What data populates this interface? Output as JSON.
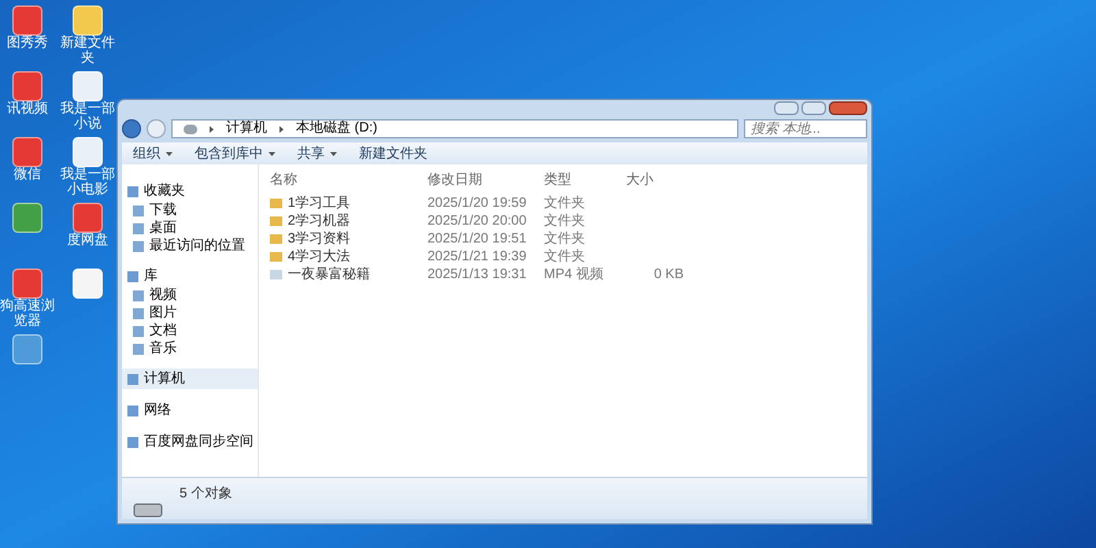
{
  "desktop_icons": [
    {
      "kind": "app",
      "label": "图秀秀"
    },
    {
      "kind": "folder",
      "label": "新建文件夹"
    },
    {
      "kind": "app",
      "label": "讯视频"
    },
    {
      "kind": "video",
      "label": "我是一部小说"
    },
    {
      "kind": "app",
      "label": "微信"
    },
    {
      "kind": "video",
      "label": "我是一部小电影"
    },
    {
      "kind": "sheet"
    },
    {
      "kind": "app",
      "label": "度网盘"
    },
    {
      "kind": "app",
      "label": "狗高速浏览器"
    },
    {
      "kind": "doc"
    },
    {
      "kind": "image"
    }
  ],
  "window": {
    "breadcrumb": [
      "计算机",
      "本地磁盘 (D:)"
    ],
    "search": {
      "placeholder": "搜索 本地..."
    },
    "toolbar": [
      "组织",
      "包含到库中",
      "共享",
      "新建文件夹"
    ],
    "sidebar": [
      {
        "label": "收藏夹",
        "children": [
          {
            "label": "下载"
          },
          {
            "label": "桌面"
          },
          {
            "label": "最近访问的位置"
          }
        ]
      },
      {
        "label": "库",
        "children": [
          {
            "label": "视频"
          },
          {
            "label": "图片"
          },
          {
            "label": "文档"
          },
          {
            "label": "音乐"
          }
        ]
      },
      {
        "label": "计算机",
        "selected": true
      },
      {
        "label": "网络",
        "selected": false
      },
      {
        "label": "百度网盘同步空间",
        "selected": false
      }
    ],
    "columns": [
      "名称",
      "修改日期",
      "类型",
      "大小"
    ],
    "rows": [
      {
        "kind": "folder",
        "name": "1学习工具",
        "date": "2025/1/20 19:59",
        "type": "文件夹",
        "size": ""
      },
      {
        "kind": "folder",
        "name": "2学习机器",
        "date": "2025/1/20 20:00",
        "type": "文件夹",
        "size": ""
      },
      {
        "kind": "folder",
        "name": "3学习资料",
        "date": "2025/1/20 19:51",
        "type": "文件夹",
        "size": ""
      },
      {
        "kind": "folder",
        "name": "4学习大法",
        "date": "2025/1/21 19:39",
        "type": "文件夹",
        "size": ""
      },
      {
        "kind": "video",
        "name": "一夜暴富秘籍",
        "date": "2025/1/13 19:31",
        "type": "MP4 视频",
        "size": "0 KB"
      }
    ],
    "status": "5 个对象"
  }
}
